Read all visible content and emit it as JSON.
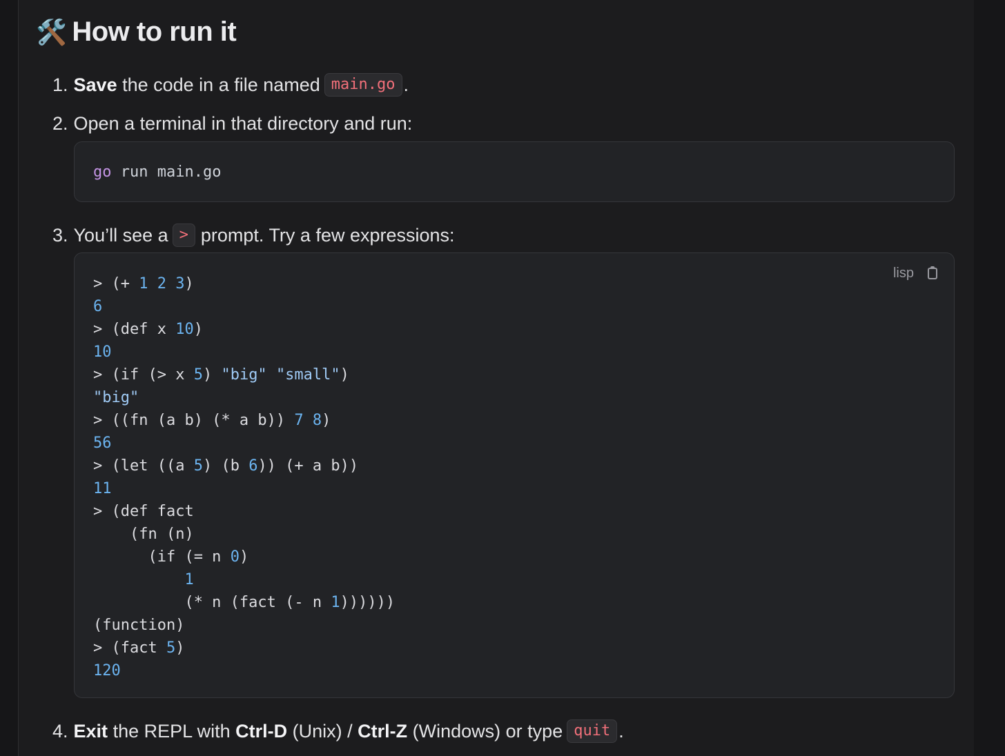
{
  "heading": {
    "emoji": "🛠️",
    "title": "How to run it"
  },
  "steps": [
    {
      "num": "1.",
      "bold": "Save",
      "text_a": " the code in a file named",
      "code": "main.go",
      "text_b": "."
    },
    {
      "num": "2.",
      "text": "Open a terminal in that directory and run:"
    },
    {
      "num": "3.",
      "text_a": "You’ll see a",
      "code": ">",
      "text_b": "prompt. Try a few expressions:"
    },
    {
      "num": "4.",
      "bold_a": "Exit",
      "text_a": " the REPL with ",
      "bold_b": "Ctrl-D",
      "text_b": " (Unix) / ",
      "bold_c": "Ctrl-Z",
      "text_c": " (Windows) or type",
      "code": "quit",
      "text_d": "."
    }
  ],
  "terminal_block": {
    "keyword": "go",
    "command": " run main.go"
  },
  "repl_block": {
    "language": "lisp",
    "copy_icon": "clipboard-icon",
    "lines": [
      "> (+ 1 2 3)",
      "6",
      "> (def x 10)",
      "10",
      "> (if (> x 5) \"big\" \"small\")",
      "\"big\"",
      "> ((fn (a b) (* a b)) 7 8)",
      "56",
      "> (let ((a 5) (b 6)) (+ a b))",
      "11",
      "> (def fact",
      "    (fn (n)",
      "      (if (= n 0)",
      "          1",
      "          (* n (fact (- n 1))))))",
      "(function)",
      "> (fact 5)",
      "120"
    ]
  },
  "colors": {
    "background": "#1c1c1e",
    "inline_code": "#f2707a",
    "number": "#6cb4f0",
    "keyword": "#c595e6"
  }
}
